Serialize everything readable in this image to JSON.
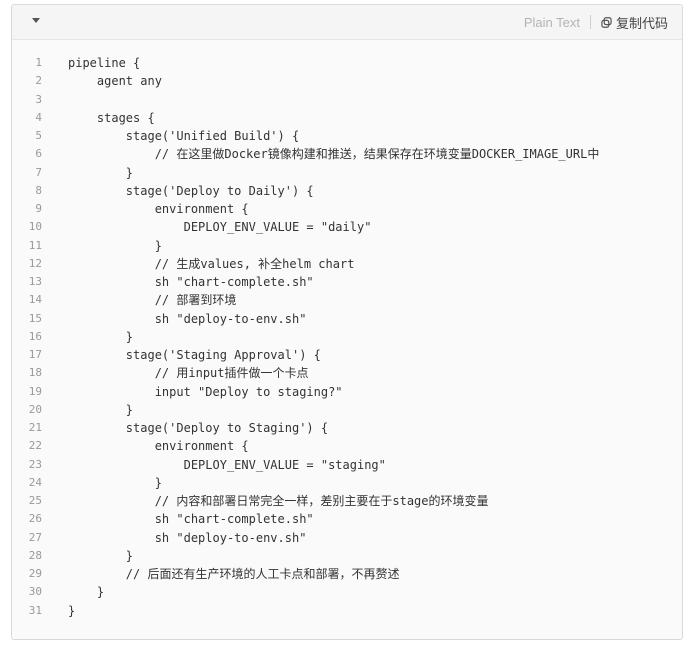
{
  "toolbar": {
    "language_label": "Plain Text",
    "copy_label": "复制代码"
  },
  "icons": {
    "collapse": "chevron-down-icon",
    "copy": "copy-link-icon"
  },
  "code_lines": [
    "pipeline {",
    "    agent any",
    "",
    "    stages {",
    "        stage('Unified Build') {",
    "            // 在这里做Docker镜像构建和推送，结果保存在环境变量DOCKER_IMAGE_URL中",
    "        }",
    "        stage('Deploy to Daily') {",
    "            environment {",
    "                DEPLOY_ENV_VALUE = \"daily\"",
    "            }",
    "            // 生成values, 补全helm chart",
    "            sh \"chart-complete.sh\"",
    "            // 部署到环境",
    "            sh \"deploy-to-env.sh\"",
    "        }",
    "        stage('Staging Approval') {",
    "            // 用input插件做一个卡点",
    "            input \"Deploy to staging?\"",
    "        }",
    "        stage('Deploy to Staging') {",
    "            environment {",
    "                DEPLOY_ENV_VALUE = \"staging\"",
    "            }",
    "            // 内容和部署日常完全一样，差别主要在于stage的环境变量",
    "            sh \"chart-complete.sh\"",
    "            sh \"deploy-to-env.sh\"",
    "        }",
    "        // 后面还有生产环境的人工卡点和部署，不再赘述",
    "    }",
    "}"
  ]
}
